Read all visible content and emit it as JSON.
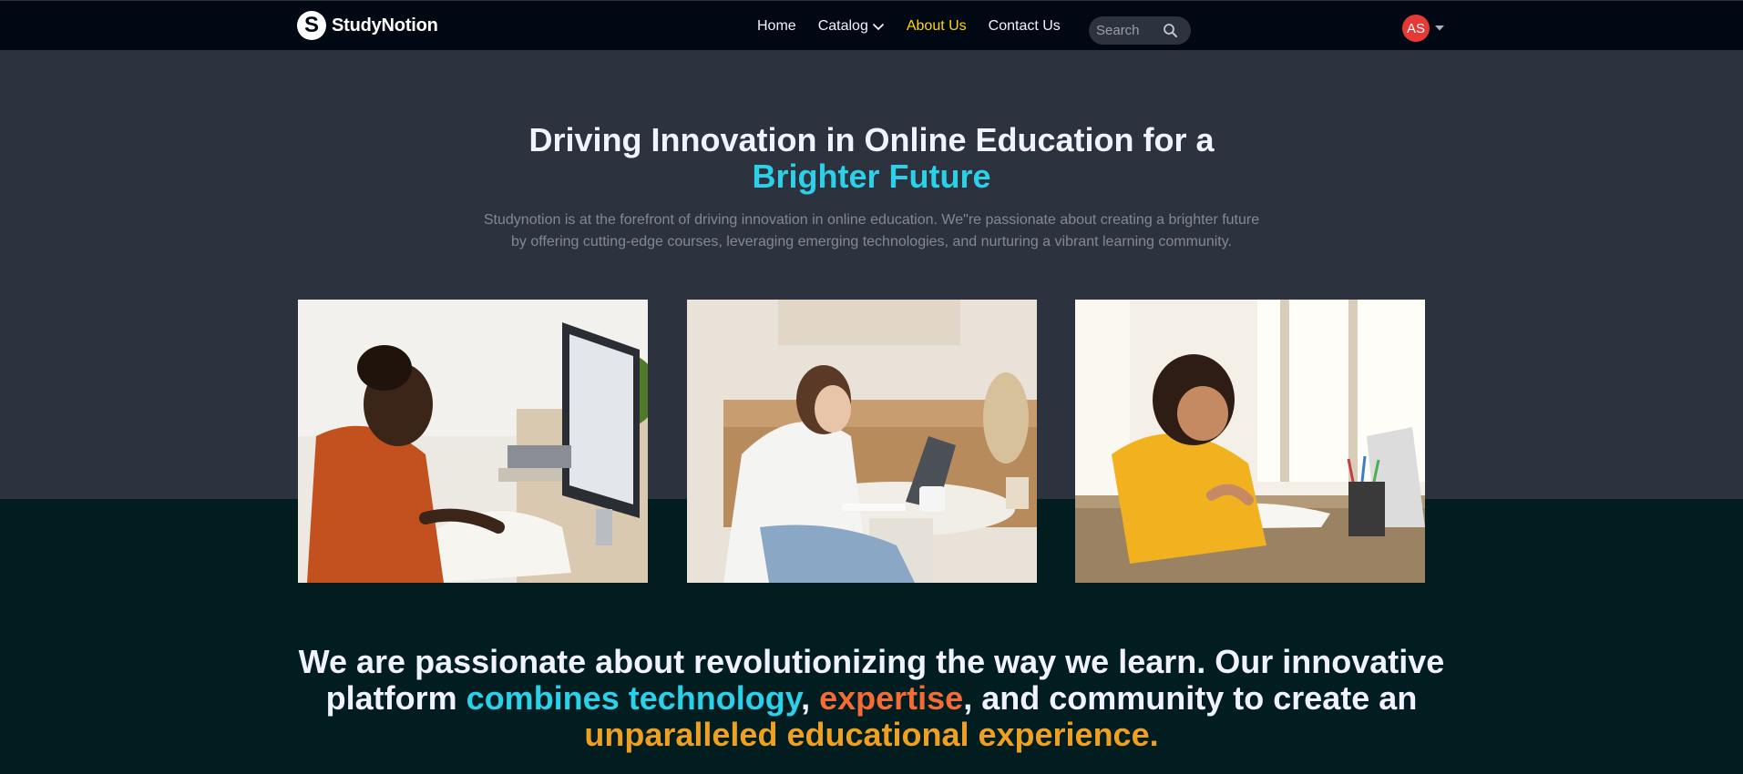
{
  "brand": {
    "name": "StudyNotion",
    "mark": "S"
  },
  "nav": {
    "home": "Home",
    "catalog": "Catalog",
    "about": "About Us",
    "contact": "Contact Us"
  },
  "search": {
    "placeholder": "Search"
  },
  "profile": {
    "initials": "AS"
  },
  "hero": {
    "title_line1": "Driving Innovation in Online Education for a",
    "title_highlight": "Brighter Future",
    "description": "Studynotion is at the forefront of driving innovation in online education. We\"re passionate about creating a brighter future by offering cutting-edge courses, leveraging emerging technologies, and nurturing a vibrant learning community."
  },
  "quote": {
    "part1": "We are passionate about revolutionizing the way we learn. Our innovative platform",
    "part2": "combines technology",
    "part3": ",",
    "part4": "expertise",
    "part5": ", and community to create an",
    "part6": "unparalleled educational experience."
  },
  "colors": {
    "background": "#000814",
    "hero_bg": "#2c333f",
    "accent_yellow": "#ffd60a",
    "accent_blue": "#2ad1e8",
    "accent_orange": "#f46b35",
    "accent_gold": "#f0a020"
  },
  "icons": [
    "logo-mark-icon",
    "chevron-down-icon",
    "search-icon",
    "caret-down-icon"
  ]
}
